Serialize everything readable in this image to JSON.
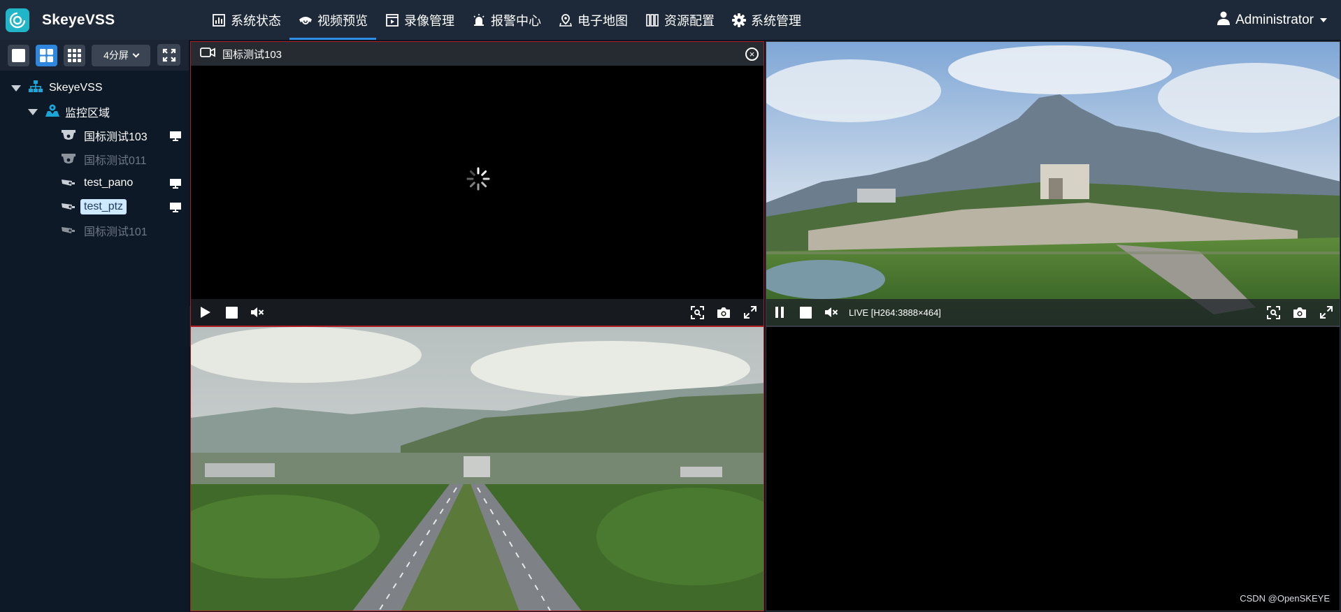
{
  "app": {
    "name": "SkeyeVSS"
  },
  "nav": {
    "items": [
      {
        "label": "系统状态",
        "icon": "bar-chart-icon"
      },
      {
        "label": "视频预览",
        "icon": "eye-camera-icon",
        "active": true
      },
      {
        "label": "录像管理",
        "icon": "film-icon"
      },
      {
        "label": "报警中心",
        "icon": "alarm-icon"
      },
      {
        "label": "电子地图",
        "icon": "map-pin-icon"
      },
      {
        "label": "资源配置",
        "icon": "books-icon"
      },
      {
        "label": "系统管理",
        "icon": "gear-icon"
      }
    ]
  },
  "user": {
    "name": "Administrator"
  },
  "toolbar": {
    "split_label": "4分屏"
  },
  "tree": {
    "root": "SkeyeVSS",
    "region": "监控区域",
    "devices": [
      {
        "label": "国标测试103",
        "online": true
      },
      {
        "label": "国标测试011",
        "online": false
      },
      {
        "label": "test_pano",
        "online": true
      },
      {
        "label": "test_ptz",
        "online": true,
        "selected": true
      },
      {
        "label": "国标测试101",
        "online": false
      }
    ]
  },
  "panes": {
    "p1": {
      "title": "国标测试103",
      "state": "loading"
    },
    "p2": {
      "status": "LIVE [H264:3888×464]"
    }
  },
  "watermark": "CSDN @OpenSKEYE",
  "colors": {
    "accent": "#2e86de",
    "selected_border": "#b01e22",
    "brand": "#21b5c8"
  }
}
